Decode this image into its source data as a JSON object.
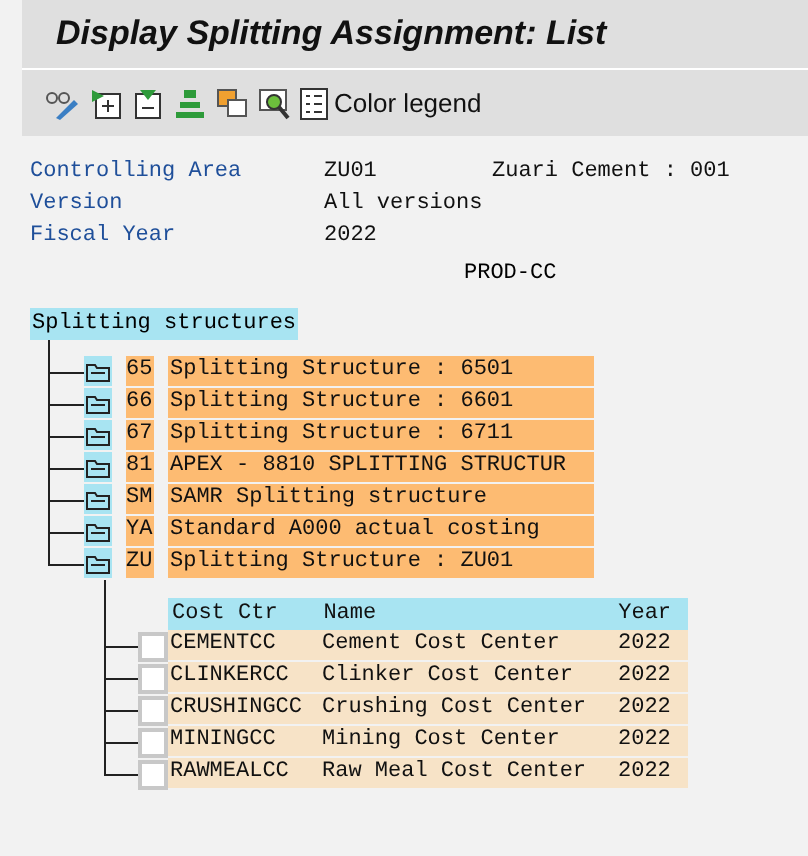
{
  "window": {
    "title": "Display Splitting Assignment: List"
  },
  "toolbar": {
    "buttons": [
      {
        "kind": "display"
      },
      {
        "kind": "expand"
      },
      {
        "kind": "collapse"
      },
      {
        "kind": "hierarchy"
      },
      {
        "kind": "windows"
      },
      {
        "kind": "find"
      },
      {
        "kind": "legend",
        "label": "Color legend"
      }
    ]
  },
  "header": [
    {
      "label": "Controlling Area",
      "value": "ZU01",
      "extra": "Zuari Cement : 001"
    },
    {
      "label": "Version",
      "value": "All versions"
    },
    {
      "label": "Fiscal Year",
      "value": "2022"
    }
  ],
  "group_label": "PROD-CC",
  "tree": {
    "root": "Splitting structures",
    "children": [
      {
        "key": "65",
        "text": "Splitting Structure : 6501"
      },
      {
        "key": "66",
        "text": "Splitting Structure : 6601"
      },
      {
        "key": "67",
        "text": "Splitting Structure : 6711"
      },
      {
        "key": "81",
        "text": "APEX - 8810 SPLITTING STRUCTUR"
      },
      {
        "key": "SM",
        "text": "SAMR Splitting structure"
      },
      {
        "key": "YA",
        "text": "Standard A000 actual costing"
      },
      {
        "key": "ZU",
        "text": "Splitting Structure : ZU01"
      }
    ]
  },
  "table": {
    "columns": [
      "Cost Ctr",
      "Name",
      "Year"
    ],
    "rows": [
      {
        "cells": [
          "CEMENTCC",
          "Cement Cost Center",
          "2022"
        ],
        "checked": false
      },
      {
        "cells": [
          "CLINKERCC",
          "Clinker Cost Center",
          "2022"
        ],
        "checked": false
      },
      {
        "cells": [
          "CRUSHINGCC",
          "Crushing Cost Center",
          "2022"
        ],
        "checked": false
      },
      {
        "cells": [
          "MININGCC",
          "Mining Cost Center",
          "2022"
        ],
        "checked": false
      },
      {
        "cells": [
          "RAWMEALCC",
          "Raw Meal Cost Center",
          "2022"
        ],
        "checked": false
      }
    ]
  }
}
